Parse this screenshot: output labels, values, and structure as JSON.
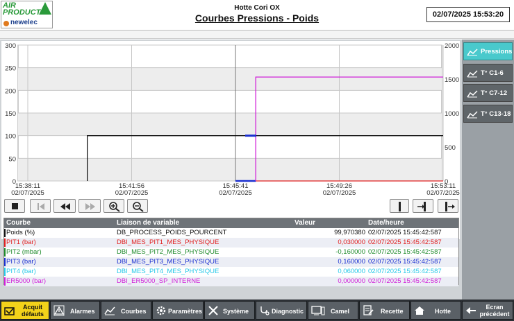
{
  "header": {
    "subtitle": "Hotte Cori OX",
    "title": "Courbes Pressions - Poids",
    "datetime": "02/07/2025 15:53:20",
    "logo": {
      "line1": "AIR",
      "line2": "PRODUCTS",
      "brand": "newelec"
    }
  },
  "side_nav": [
    {
      "label": "Pressions",
      "icon": "trend-icon",
      "active": true
    },
    {
      "label": "T° C1-6",
      "icon": "trend-icon",
      "active": false
    },
    {
      "label": "T° C7-12",
      "icon": "trend-icon",
      "active": false
    },
    {
      "label": "T° C13-18",
      "icon": "trend-icon",
      "active": false
    }
  ],
  "chart_data": {
    "type": "line",
    "left_axis": {
      "min": 0,
      "max": 300,
      "ticks": [
        "0",
        "50",
        "100",
        "150",
        "200",
        "250",
        "300"
      ]
    },
    "right_axis": {
      "min": 0,
      "max": 2000,
      "ticks": [
        "0",
        "500",
        "1000",
        "1500",
        "2000"
      ]
    },
    "x_ticks": [
      {
        "time": "15:38:11",
        "date": "02/07/2025"
      },
      {
        "time": "15:41:56",
        "date": "02/07/2025"
      },
      {
        "time": "15:45:41",
        "date": "02/07/2025"
      },
      {
        "time": "15:49:26",
        "date": "02/07/2025"
      },
      {
        "time": "15:53:11",
        "date": "02/07/2025"
      }
    ],
    "series": [
      {
        "name": "Poids (%)",
        "color": "#111111",
        "axis": "left",
        "points": [
          [
            "15:40:20",
            0
          ],
          [
            "15:40:20",
            100
          ],
          [
            "15:53:11",
            100
          ]
        ]
      },
      {
        "name": "PIT1 (bar)",
        "color": "#e02020",
        "axis": "left",
        "points": [
          [
            "15:45:41",
            0
          ],
          [
            "15:53:11",
            0
          ]
        ]
      },
      {
        "name": "PIT3 (bar)",
        "color": "#1a2fd0",
        "axis": "left",
        "points": [
          [
            "15:45:41",
            0
          ],
          [
            "15:46:25",
            0
          ]
        ]
      },
      {
        "name": "ER5000 (bar)",
        "color": "#d020d8",
        "axis": "right",
        "points": [
          [
            "15:46:25",
            0
          ],
          [
            "15:46:25",
            1530
          ],
          [
            "15:53:11",
            1530
          ]
        ]
      }
    ],
    "grid": true
  },
  "toolbar": [
    {
      "name": "stop-button",
      "icon": "stop-icon"
    },
    {
      "name": "first-button",
      "icon": "skip-back-icon"
    },
    {
      "name": "rewind-button",
      "icon": "rewind-icon"
    },
    {
      "name": "forward-button",
      "icon": "fast-forward-icon"
    },
    {
      "name": "zoom-in-button",
      "icon": "zoom-in-icon"
    },
    {
      "name": "zoom-out-button",
      "icon": "zoom-out-icon"
    },
    {
      "name": "ruler-button",
      "icon": "ruler-icon"
    },
    {
      "name": "ruler-move-button",
      "icon": "ruler-move-icon"
    },
    {
      "name": "ruler-end-button",
      "icon": "ruler-end-icon"
    }
  ],
  "legend_table": {
    "headers": [
      "Courbe",
      "Liaison de variable",
      "Valeur",
      "Date/heure"
    ],
    "rows": [
      {
        "curve": "Poids (%)",
        "var": "DB_PROCESS_POIDS_POURCENT",
        "value": "99,970380",
        "time": "02/07/2025 15:45:42:587",
        "color": "#111111"
      },
      {
        "curve": "PIT1 (bar)",
        "var": "DBI_MES_PIT1_MES_PHYSIQUE",
        "value": "0,030000",
        "time": "02/07/2025 15:45:42:587",
        "color": "#e02020"
      },
      {
        "curve": "PIT2 (mbar)",
        "var": "DBI_MES_PIT2_MES_PHYSIQUE",
        "value": "-0,160000",
        "time": "02/07/2025 15:45:42:587",
        "color": "#1d8a2a"
      },
      {
        "curve": "PIT3 (bar)",
        "var": "DBI_MES_PIT3_MES_PHYSIQUE",
        "value": "0,160000",
        "time": "02/07/2025 15:45:42:587",
        "color": "#1a2fd0"
      },
      {
        "curve": "PIT4 (bar)",
        "var": "DBI_MES_PIT4_MES_PHYSIQUE",
        "value": "0,060000",
        "time": "02/07/2025 15:45:42:587",
        "color": "#25c8e8"
      },
      {
        "curve": "ER5000 (bar)",
        "var": "DBI_ER5000_SP_INTERNE",
        "value": "0,000000",
        "time": "02/07/2025 15:45:42:587",
        "color": "#d020d8"
      }
    ]
  },
  "footer": [
    {
      "label": "Acquit défauts",
      "line1": "Acquit",
      "line2": "défauts",
      "icon": "acknowledge-icon",
      "yellow": true
    },
    {
      "label": "Alarmes",
      "icon": "alarm-icon"
    },
    {
      "label": "Courbes",
      "icon": "trend-icon"
    },
    {
      "label": "Paramètres",
      "icon": "gear-icon"
    },
    {
      "label": "Système",
      "icon": "tools-icon"
    },
    {
      "label": "Diagnostic",
      "icon": "stethoscope-icon"
    },
    {
      "label": "Camel",
      "icon": "monitor-icon"
    },
    {
      "label": "Recette",
      "icon": "recipe-icon"
    },
    {
      "label": "Hotte",
      "icon": "home-icon"
    },
    {
      "label": "Ecran précédent",
      "line1": "Ecran",
      "line2": "précédent",
      "icon": "back-arrow-icon"
    }
  ]
}
